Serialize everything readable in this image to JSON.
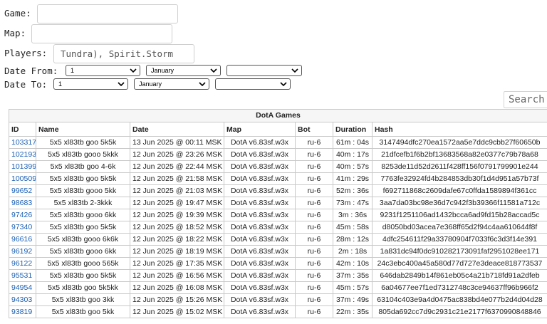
{
  "form": {
    "game_label": "Game:",
    "game_value": "",
    "map_label": "Map:",
    "map_value": "",
    "players_label": "Players:",
    "players_value": "Tundra), Spirit.Storm",
    "date_from_label": "Date From:",
    "date_from_day": "1",
    "date_from_month": "January",
    "date_from_year": "",
    "date_to_label": "Date To:",
    "date_to_day": "1",
    "date_to_month": "January",
    "date_to_year": "",
    "search_label": "Search"
  },
  "table": {
    "title": "DotA Games",
    "columns": [
      "ID",
      "Name",
      "Date",
      "Map",
      "Bot",
      "Duration",
      "Hash"
    ],
    "rows": [
      [
        "103317",
        "5x5 xl83tb goo 5k5k",
        "13 Jun 2025 @ 00:11 MSK",
        "DotA v6.83sf.w3x",
        "ru-6",
        "61m : 04s",
        "3147494dfc270ea1572aa5e7ddc9cbb27f60650b"
      ],
      [
        "102193",
        "5x5 xl83tb gooo 5kkk",
        "12 Jun 2025 @ 23:26 MSK",
        "DotA v6.83sf.w3x",
        "ru-6",
        "40m : 17s",
        "21dfcefb1f6b2bf13683568a82e0377c79b78a68"
      ],
      [
        "101399",
        "5x5 xl83tb goo 4-6k",
        "12 Jun 2025 @ 22:44 MSK",
        "DotA v6.83sf.w3x",
        "ru-6",
        "40m : 57s",
        "8253de11d52d2611f428ff156f0791799901e244"
      ],
      [
        "100509",
        "5x5 xl83tb goo 5k5k",
        "12 Jun 2025 @ 21:58 MSK",
        "DotA v6.83sf.w3x",
        "ru-6",
        "41m : 29s",
        "7763fe32924fd4b284853db30f1d4d951a57b73f"
      ],
      [
        "99652",
        "5x5 xl83tb gooo 5kk",
        "12 Jun 2025 @ 21:03 MSK",
        "DotA v6.83sf.w3x",
        "ru-6",
        "52m : 36s",
        "f692711868c2609dafe67c0ffda1589894f361cc"
      ],
      [
        "98683",
        "5x5 xl83tb 2-3kkk",
        "12 Jun 2025 @ 19:47 MSK",
        "DotA v6.83sf.w3x",
        "ru-6",
        "73m : 47s",
        "3aa7da03bc98e36d7c942f3b39366f11581a712c"
      ],
      [
        "97426",
        "5x5 xl83tb gooo 6kk",
        "12 Jun 2025 @ 19:39 MSK",
        "DotA v6.83sf.w3x",
        "ru-6",
        "3m : 36s",
        "9231f1251106ad1432bcca6ad9fd15b28accad5c"
      ],
      [
        "97340",
        "5x5 xl83tb goo 5k5k",
        "12 Jun 2025 @ 18:52 MSK",
        "DotA v6.83sf.w3x",
        "ru-6",
        "45m : 58s",
        "d8050bd03acea7e368ff65d2f94c4aa610644f8f"
      ],
      [
        "96616",
        "5x5 xl83tb gooo 6k6k",
        "12 Jun 2025 @ 18:22 MSK",
        "DotA v6.83sf.w3x",
        "ru-6",
        "28m : 12s",
        "4dfc254611f29a33780904f7033f6c3d3f14e391"
      ],
      [
        "96192",
        "5x5 xl83tb gooo 6kk",
        "12 Jun 2025 @ 18:19 MSK",
        "DotA v6.83sf.w3x",
        "ru-6",
        "2m : 18s",
        "1a831dc94f0dc910282173091faf2951028ee171"
      ],
      [
        "96122",
        "5x5 xl83tb gooo 565k",
        "12 Jun 2025 @ 17:35 MSK",
        "DotA v6.83sf.w3x",
        "ru-6",
        "42m : 10s",
        "24c3ebc400a45a580d77d727e3deace818773537"
      ],
      [
        "95531",
        "5x5 xl83tb goo 5k5k",
        "12 Jun 2025 @ 16:56 MSK",
        "DotA v6.83sf.w3x",
        "ru-6",
        "37m : 35s",
        "646dab2849b14f861eb05c4a21b718fd91a2dfeb"
      ],
      [
        "94954",
        "5x5 xl83tb goo 5k5kk",
        "12 Jun 2025 @ 16:08 MSK",
        "DotA v6.83sf.w3x",
        "ru-6",
        "45m : 57s",
        "6a04677ee7f1ed7312748c3ce94637ff96b966f2"
      ],
      [
        "94303",
        "5x5 xl83tb goo 3kk",
        "12 Jun 2025 @ 15:26 MSK",
        "DotA v6.83sf.w3x",
        "ru-6",
        "37m : 49s",
        "63104c403e9a4d0475ac838bd4e077b2d4d04d28"
      ],
      [
        "93819",
        "5x5 xl83tb goo 5kk",
        "12 Jun 2025 @ 15:02 MSK",
        "DotA v6.83sf.w3x",
        "ru-6",
        "22m : 35s",
        "805da692cc7d9c2931c21e2177f6370990848846"
      ]
    ]
  }
}
